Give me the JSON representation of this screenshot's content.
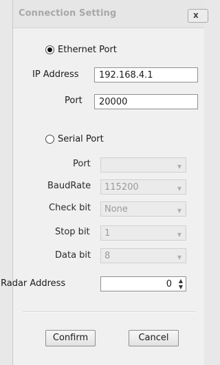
{
  "window": {
    "title": "Connection Setting",
    "close_glyph": "x"
  },
  "ethernet": {
    "radio_label": "Ethernet Port",
    "selected": true,
    "ip_label": "IP Address",
    "ip_value": "192.168.4.1",
    "port_label": "Port",
    "port_value": "20000"
  },
  "serial": {
    "radio_label": "Serial Port",
    "selected": false,
    "port_label": "Port",
    "port_value": "",
    "baud_label": "BaudRate",
    "baud_value": "115200",
    "check_label": "Check bit",
    "check_value": "None",
    "stop_label": "Stop bit",
    "stop_value": "1",
    "data_label": "Data bit",
    "data_value": "8"
  },
  "radar": {
    "label": "Radar Address",
    "value": "0"
  },
  "buttons": {
    "confirm": "Confirm",
    "cancel": "Cancel"
  },
  "icons": {
    "dropdown": "chevron-down-icon",
    "spin": "spin-updown-icon",
    "close": "close-icon"
  }
}
